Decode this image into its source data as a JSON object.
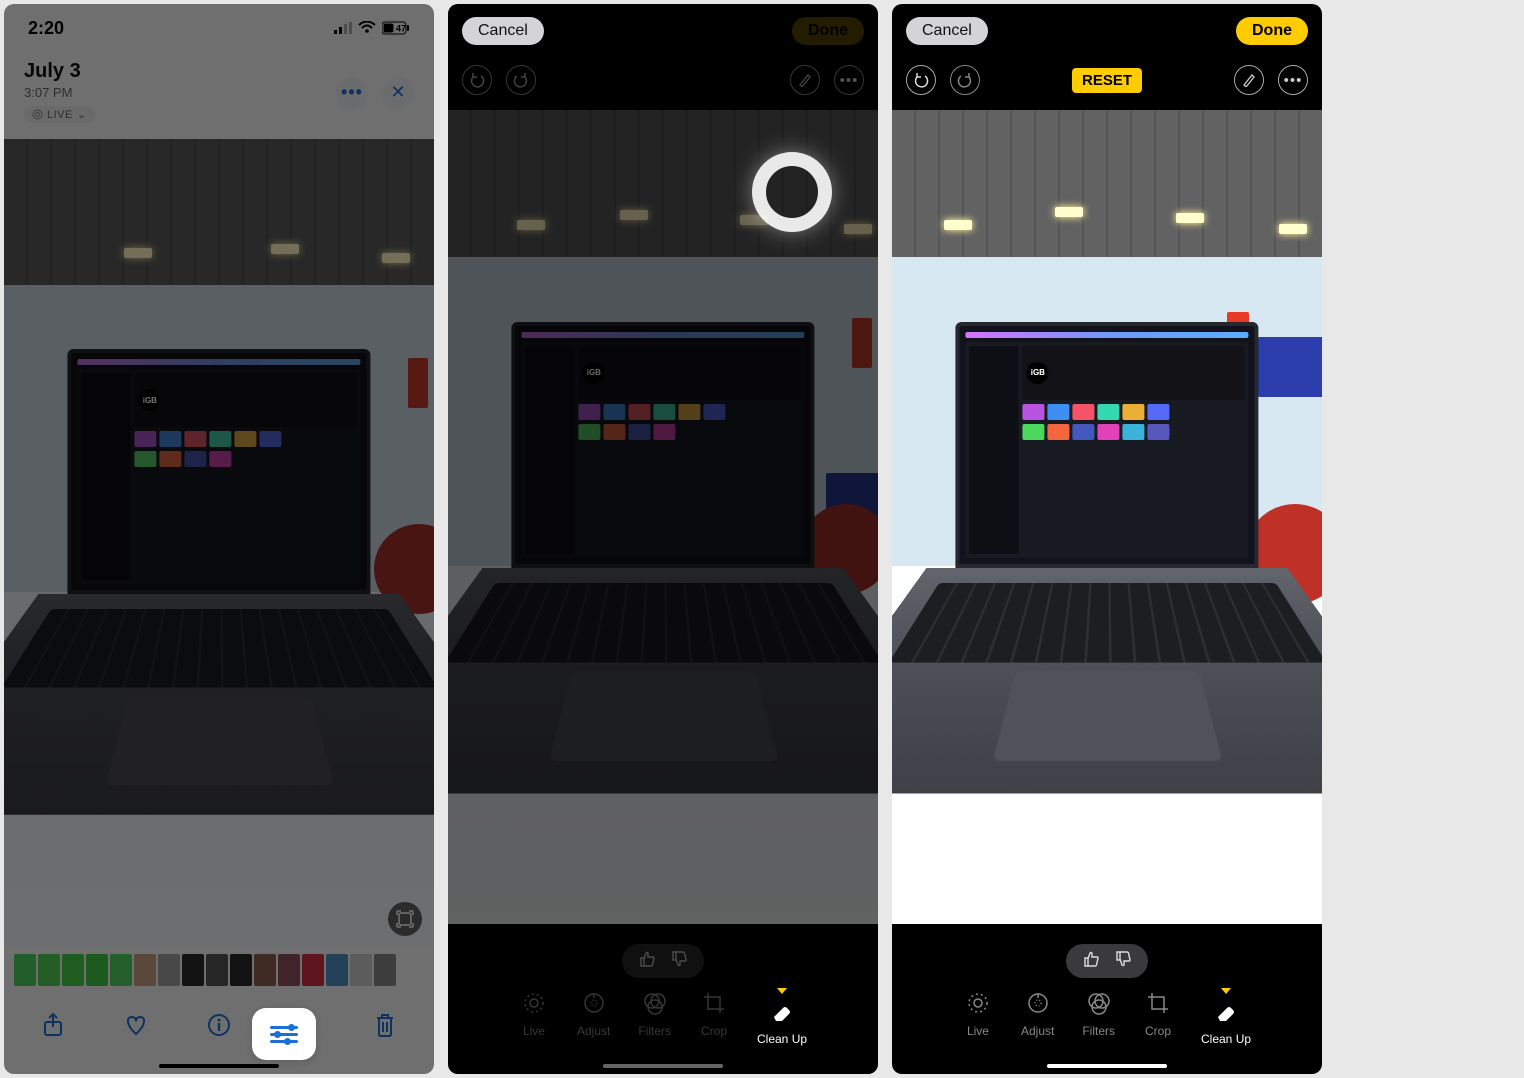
{
  "screen1": {
    "status": {
      "time": "2:20",
      "battery": "47"
    },
    "date_title": "July 3",
    "date_time": "3:07 PM",
    "live_label": "LIVE",
    "toolbar_icons": {
      "share": "share-icon",
      "heart": "heart-icon",
      "info": "info-icon",
      "adjust": "adjust-icon",
      "trash": "trash-icon"
    }
  },
  "screen2": {
    "cancel_label": "Cancel",
    "done_label": "Done",
    "tabs": {
      "live": "Live",
      "adjust": "Adjust",
      "filters": "Filters",
      "crop": "Crop",
      "clean_up": "Clean Up"
    }
  },
  "screen3": {
    "cancel_label": "Cancel",
    "done_label": "Done",
    "reset_label": "RESET",
    "tabs": {
      "live": "Live",
      "adjust": "Adjust",
      "filters": "Filters",
      "crop": "Crop",
      "clean_up": "Clean Up"
    }
  },
  "laptop_brand": "iGB"
}
